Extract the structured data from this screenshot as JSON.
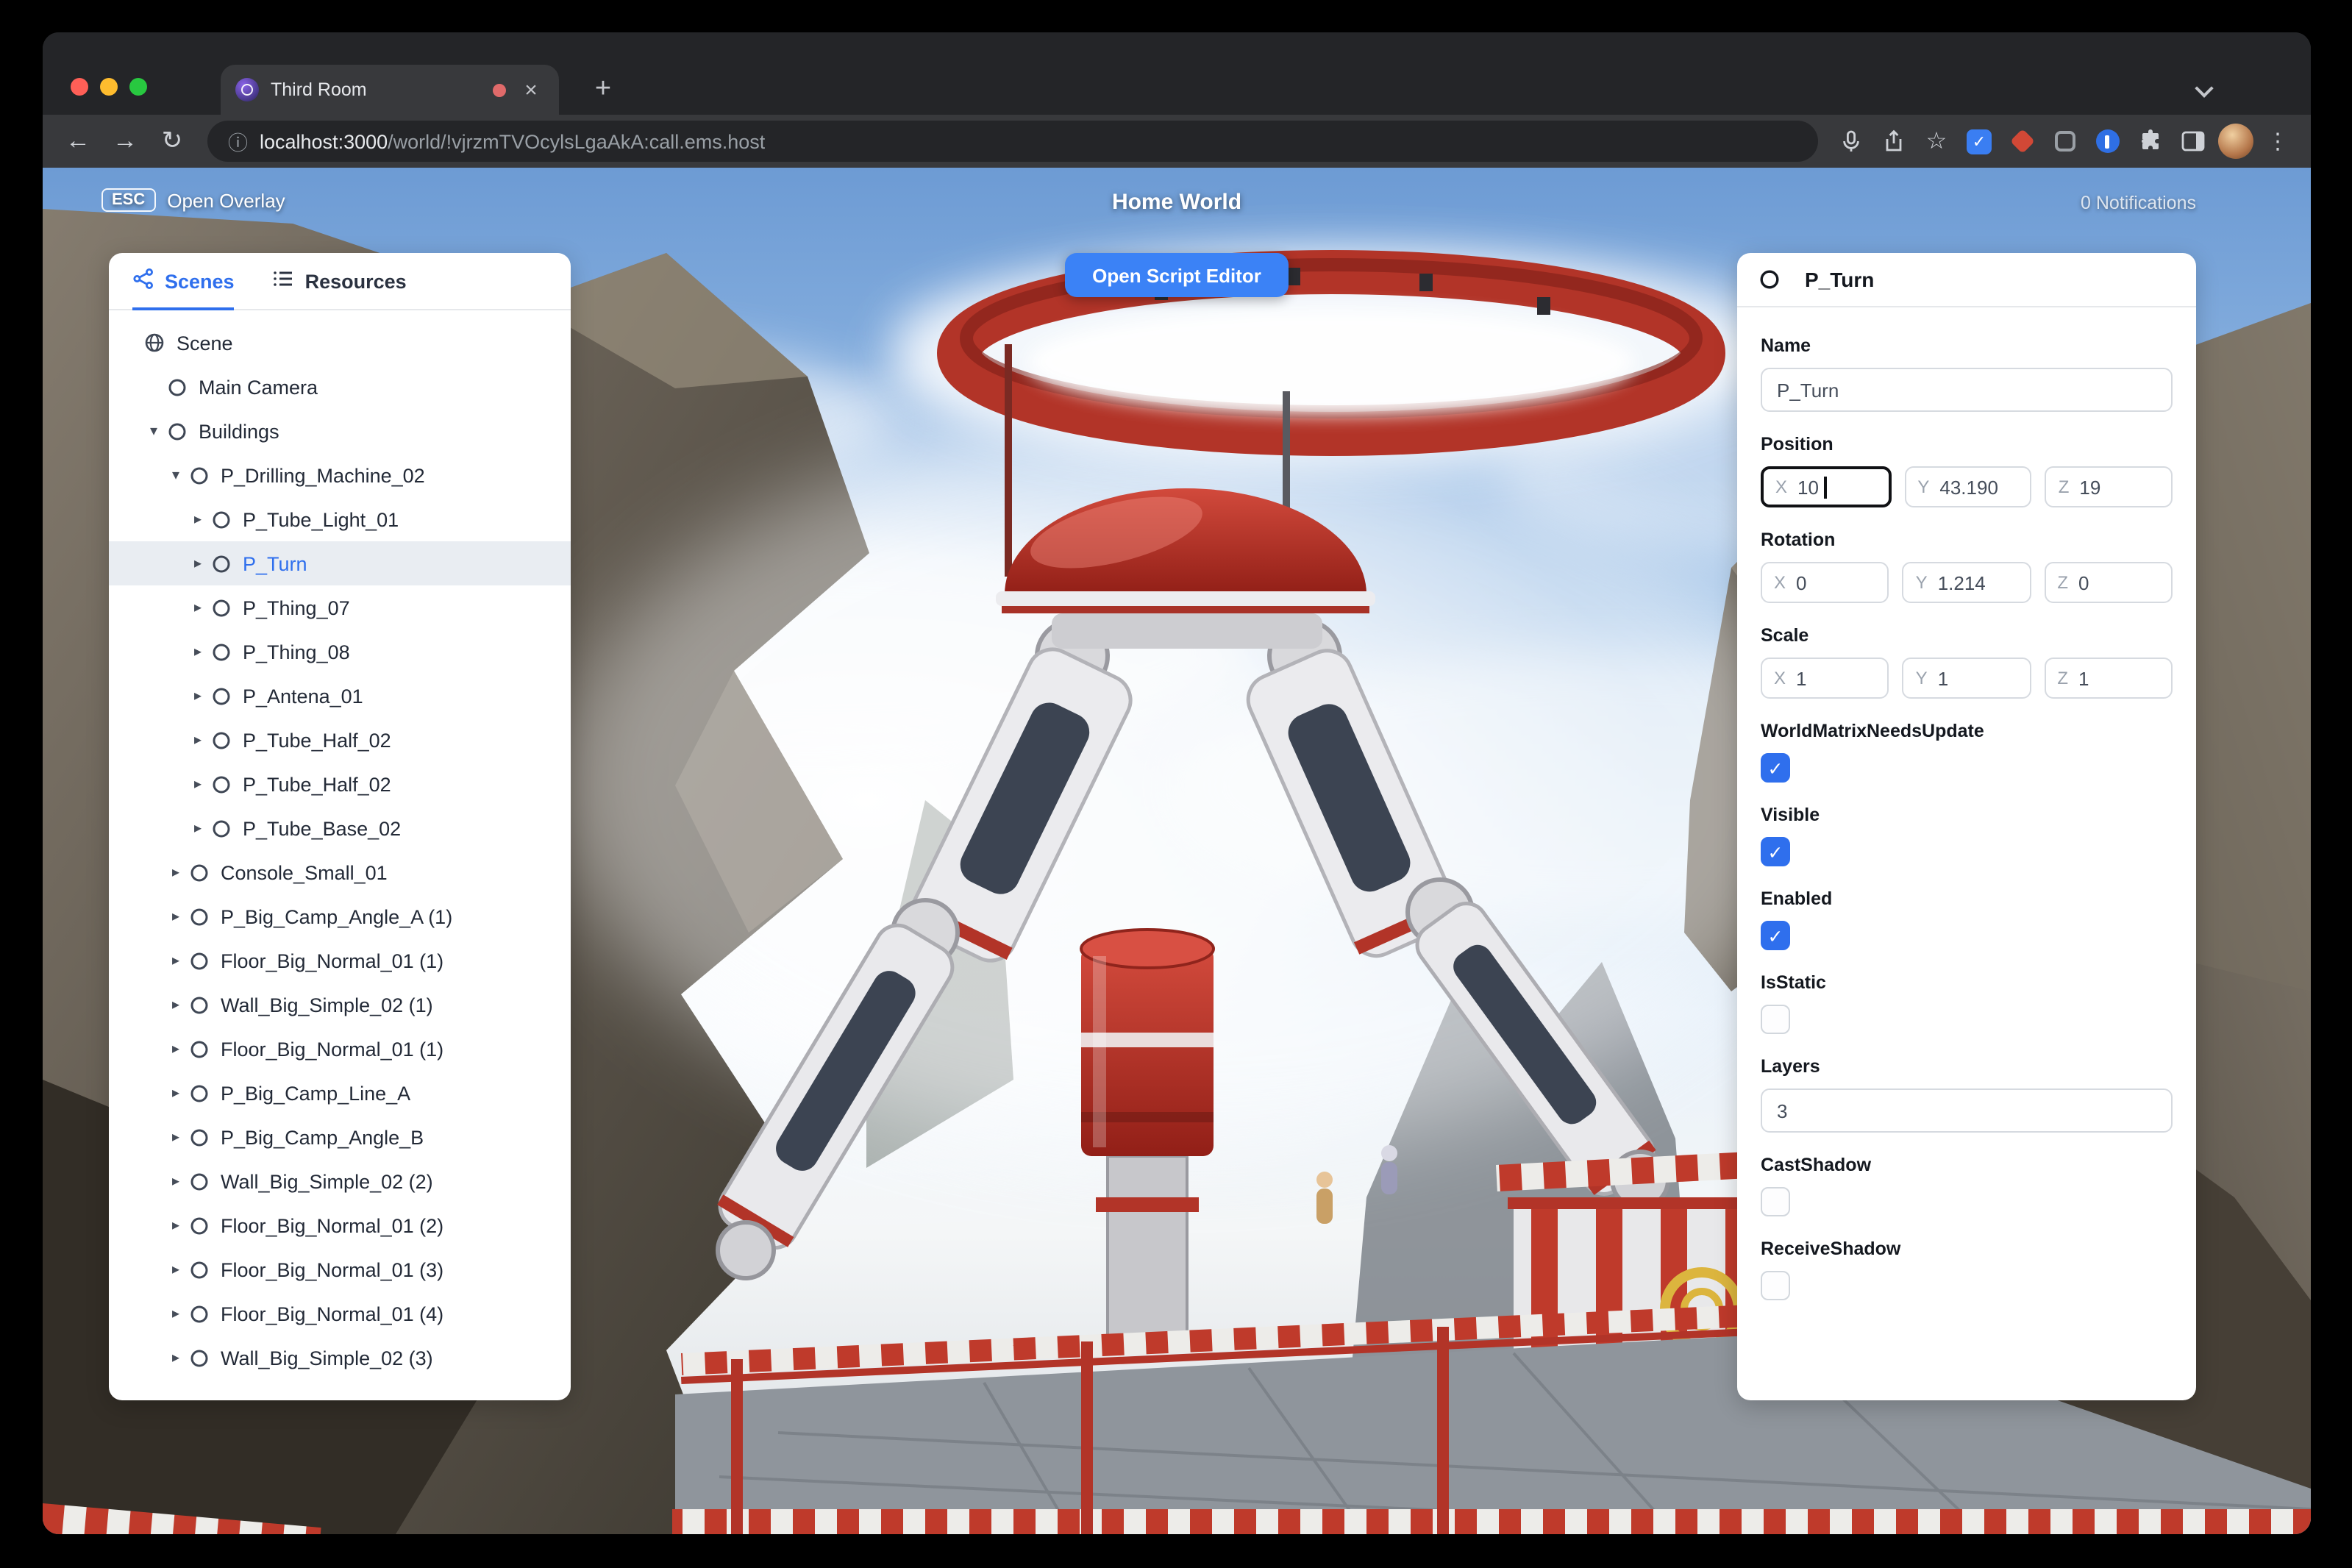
{
  "browser": {
    "tab_title": "Third Room",
    "url_host": "localhost:3000",
    "url_path": "/world/!vjrzmTVOcylsLgaAkA:call.ems.host"
  },
  "icons": {
    "close": "×",
    "new_tab": "+",
    "back": "←",
    "forward": "→",
    "reload": "↻",
    "star": "☆",
    "more": "⋮",
    "info": "ⓘ",
    "caret_down": "▾",
    "caret_right": "▸",
    "check": "✓"
  },
  "colors": {
    "accent_blue": "#3b82f6",
    "selected_row": "#e9edf2",
    "machine_red": "#b23428"
  },
  "hud": {
    "esc_key": "ESC",
    "open_overlay_label": "Open Overlay",
    "world_title": "Home World",
    "notifications_label": "0 Notifications",
    "open_script_editor_label": "Open Script Editor"
  },
  "left_panel": {
    "tabs": [
      {
        "label": "Scenes",
        "active": true
      },
      {
        "label": "Resources",
        "active": false
      }
    ],
    "tree": [
      {
        "label": "Scene",
        "depth": 0,
        "icon": "globe"
      },
      {
        "label": "Main Camera",
        "depth": 1,
        "icon": "circle"
      },
      {
        "label": "Buildings",
        "depth": 1,
        "icon": "circle",
        "caret": "down"
      },
      {
        "label": "P_Drilling_Machine_02",
        "depth": 2,
        "icon": "circle",
        "caret": "down"
      },
      {
        "label": "P_Tube_Light_01",
        "depth": 3,
        "icon": "circle",
        "caret": "right"
      },
      {
        "label": "P_Turn",
        "depth": 3,
        "icon": "circle",
        "caret": "right",
        "selected": true
      },
      {
        "label": "P_Thing_07",
        "depth": 3,
        "icon": "circle",
        "caret": "right"
      },
      {
        "label": "P_Thing_08",
        "depth": 3,
        "icon": "circle",
        "caret": "right"
      },
      {
        "label": "P_Antena_01",
        "depth": 3,
        "icon": "circle",
        "caret": "right"
      },
      {
        "label": "P_Tube_Half_02",
        "depth": 3,
        "icon": "circle",
        "caret": "right"
      },
      {
        "label": "P_Tube_Half_02",
        "depth": 3,
        "icon": "circle",
        "caret": "right"
      },
      {
        "label": "P_Tube_Base_02",
        "depth": 3,
        "icon": "circle",
        "caret": "right"
      },
      {
        "label": "Console_Small_01",
        "depth": 2,
        "icon": "circle",
        "caret": "right"
      },
      {
        "label": "P_Big_Camp_Angle_A (1)",
        "depth": 2,
        "icon": "circle",
        "caret": "right"
      },
      {
        "label": "Floor_Big_Normal_01 (1)",
        "depth": 2,
        "icon": "circle",
        "caret": "right"
      },
      {
        "label": "Wall_Big_Simple_02 (1)",
        "depth": 2,
        "icon": "circle",
        "caret": "right"
      },
      {
        "label": "Floor_Big_Normal_01 (1)",
        "depth": 2,
        "icon": "circle",
        "caret": "right"
      },
      {
        "label": "P_Big_Camp_Line_A",
        "depth": 2,
        "icon": "circle",
        "caret": "right"
      },
      {
        "label": "P_Big_Camp_Angle_B",
        "depth": 2,
        "icon": "circle",
        "caret": "right"
      },
      {
        "label": "Wall_Big_Simple_02 (2)",
        "depth": 2,
        "icon": "circle",
        "caret": "right"
      },
      {
        "label": "Floor_Big_Normal_01 (2)",
        "depth": 2,
        "icon": "circle",
        "caret": "right"
      },
      {
        "label": "Floor_Big_Normal_01 (3)",
        "depth": 2,
        "icon": "circle",
        "caret": "right"
      },
      {
        "label": "Floor_Big_Normal_01 (4)",
        "depth": 2,
        "icon": "circle",
        "caret": "right"
      },
      {
        "label": "Wall_Big_Simple_02 (3)",
        "depth": 2,
        "icon": "circle",
        "caret": "right"
      }
    ]
  },
  "inspector": {
    "title": "P_Turn",
    "fields": [
      {
        "type": "text",
        "label": "Name",
        "value": "P_Turn"
      },
      {
        "type": "vec3",
        "label": "Position",
        "axes": [
          {
            "k": "X",
            "v": "10",
            "focused": true
          },
          {
            "k": "Y",
            "v": "43.190"
          },
          {
            "k": "Z",
            "v": "19"
          }
        ]
      },
      {
        "type": "vec3",
        "label": "Rotation",
        "axes": [
          {
            "k": "X",
            "v": "0"
          },
          {
            "k": "Y",
            "v": "1.214"
          },
          {
            "k": "Z",
            "v": "0"
          }
        ]
      },
      {
        "type": "vec3",
        "label": "Scale",
        "axes": [
          {
            "k": "X",
            "v": "1"
          },
          {
            "k": "Y",
            "v": "1"
          },
          {
            "k": "Z",
            "v": "1"
          }
        ]
      },
      {
        "type": "checkbox",
        "label": "WorldMatrixNeedsUpdate",
        "checked": true
      },
      {
        "type": "checkbox",
        "label": "Visible",
        "checked": true
      },
      {
        "type": "checkbox",
        "label": "Enabled",
        "checked": true
      },
      {
        "type": "checkbox",
        "label": "IsStatic",
        "checked": false
      },
      {
        "type": "text",
        "label": "Layers",
        "value": "3"
      },
      {
        "type": "checkbox",
        "label": "CastShadow",
        "checked": false
      },
      {
        "type": "checkbox",
        "label": "ReceiveShadow",
        "checked": false
      }
    ]
  }
}
